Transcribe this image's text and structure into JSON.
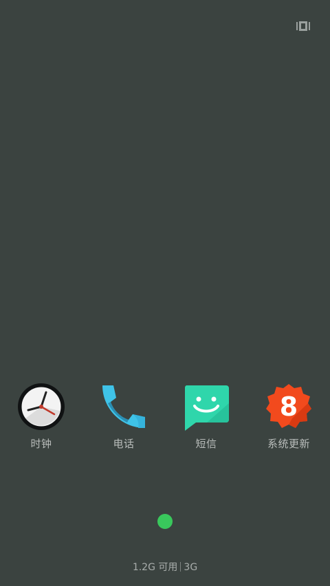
{
  "status": {
    "recents_icon": "recent-apps-icon"
  },
  "apps": [
    {
      "label": "时钟",
      "icon": "clock-icon"
    },
    {
      "label": "电话",
      "icon": "phone-icon"
    },
    {
      "label": "短信",
      "icon": "messages-icon"
    },
    {
      "label": "系统更新",
      "icon": "system-update-icon"
    }
  ],
  "pager": {
    "current_page": 1,
    "total_pages": 1,
    "active_color": "#39c85c"
  },
  "memory": {
    "available": "1.2G 可用",
    "total": "3G"
  },
  "colors": {
    "background": "#3b4340",
    "label_text": "#b9bdbb"
  }
}
